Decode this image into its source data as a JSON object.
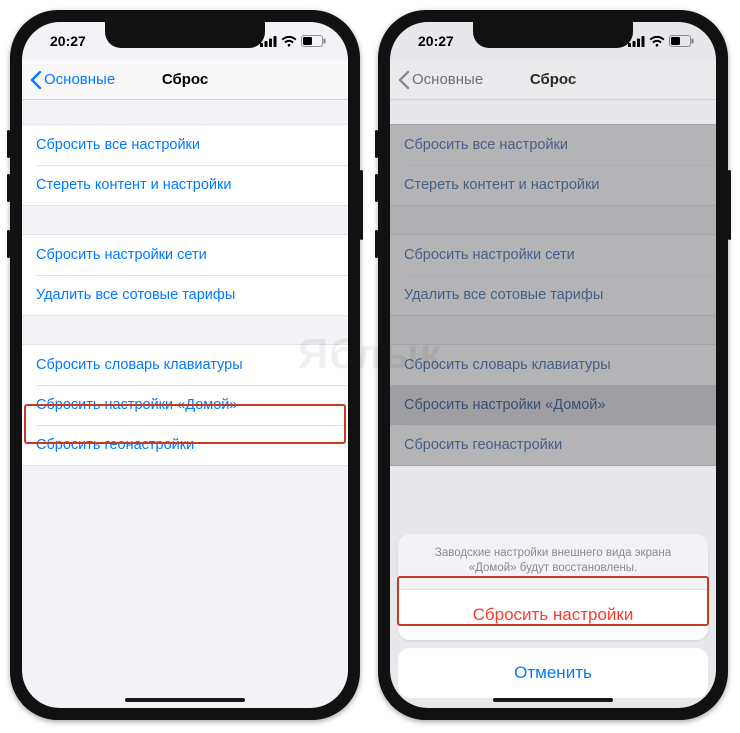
{
  "watermark": "Яблык",
  "status": {
    "time": "20:27"
  },
  "nav": {
    "back": "Основные",
    "title": "Сброс"
  },
  "groups": [
    {
      "rows": [
        "Сбросить все настройки",
        "Стереть контент и настройки"
      ]
    },
    {
      "rows": [
        "Сбросить настройки сети",
        "Удалить все сотовые тарифы"
      ]
    },
    {
      "rows": [
        "Сбросить словарь клавиатуры",
        "Сбросить настройки «Домой»",
        "Сбросить геонастройки"
      ]
    }
  ],
  "actionsheet": {
    "message": "Заводские настройки внешнего вида экрана «Домой» будут восстановлены.",
    "confirm": "Сбросить настройки",
    "cancel": "Отменить"
  },
  "colors": {
    "link": "#007aff",
    "destructive": "#ff3b30",
    "highlight": "#c23b22",
    "bg": "#f2f2f7"
  }
}
